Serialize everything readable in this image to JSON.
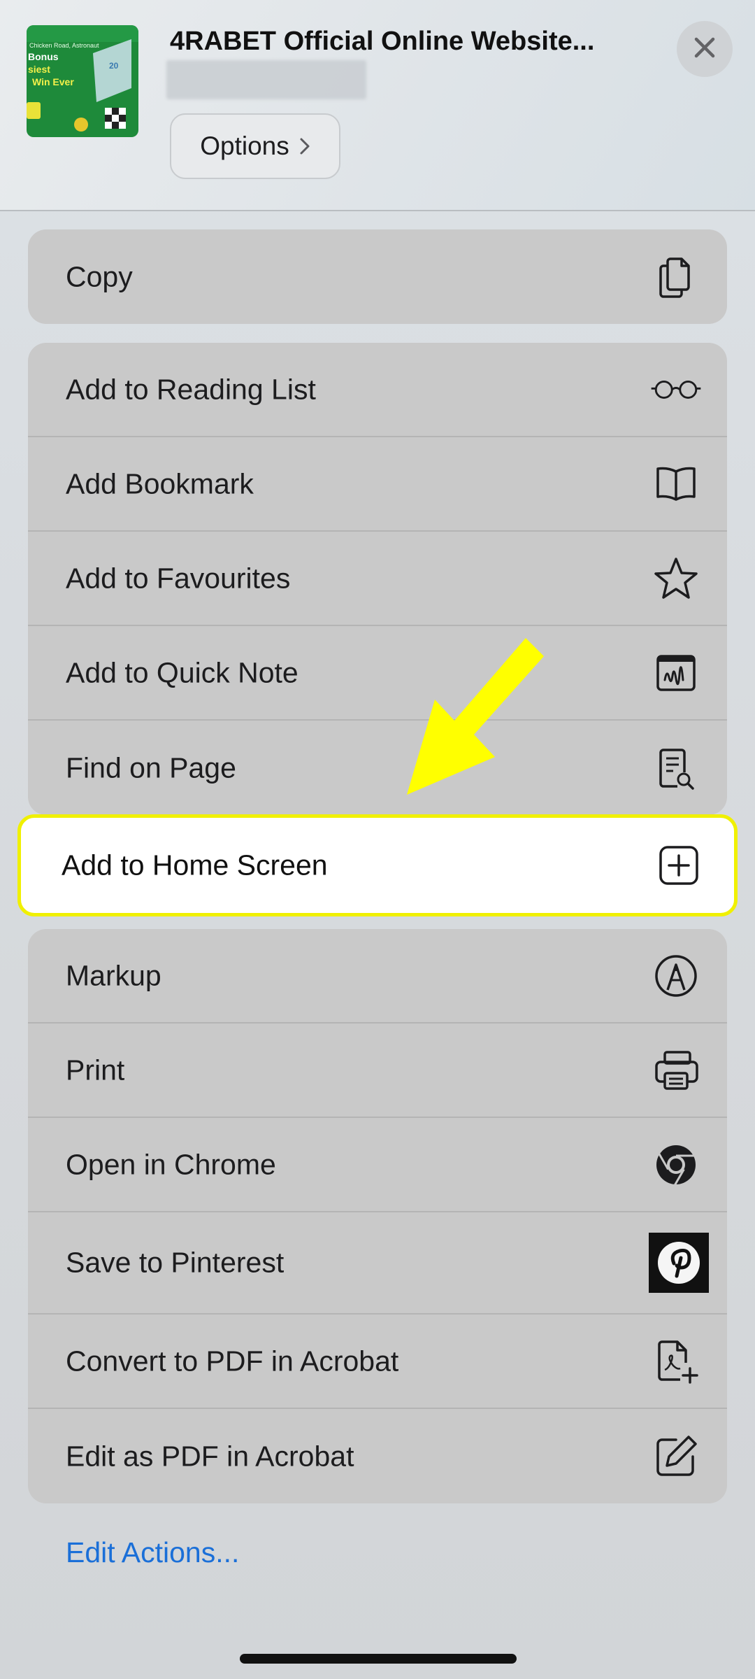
{
  "header": {
    "site_title": "4RABET Official Online Website...",
    "options_label": "Options",
    "thumbnail": {
      "line1": "Chicken Road, Astronaut",
      "line2": "Bonus",
      "line3": "siest",
      "line4": "Win Ever",
      "badge": "20"
    }
  },
  "groups": [
    {
      "items": [
        {
          "label": "Copy",
          "icon": "copy-icon"
        }
      ]
    },
    {
      "items": [
        {
          "label": "Add to Reading List",
          "icon": "glasses-icon"
        },
        {
          "label": "Add Bookmark",
          "icon": "book-icon"
        },
        {
          "label": "Add to Favourites",
          "icon": "star-icon"
        },
        {
          "label": "Add to Quick Note",
          "icon": "quick-note-icon"
        },
        {
          "label": "Find on Page",
          "icon": "find-document-icon"
        }
      ]
    },
    {
      "items": [
        {
          "label": "Add to Home Screen",
          "icon": "plus-square-icon",
          "highlighted": true
        }
      ]
    },
    {
      "items": [
        {
          "label": "Markup",
          "icon": "markup-pen-icon"
        },
        {
          "label": "Print",
          "icon": "printer-icon"
        },
        {
          "label": "Open in Chrome",
          "icon": "chrome-icon"
        },
        {
          "label": "Save to Pinterest",
          "icon": "pinterest-icon"
        },
        {
          "label": "Convert to PDF in Acrobat",
          "icon": "pdf-add-icon"
        },
        {
          "label": "Edit as PDF in Acrobat",
          "icon": "edit-square-icon"
        }
      ]
    }
  ],
  "footer": {
    "edit_actions": "Edit Actions..."
  },
  "colors": {
    "highlight_border": "#f0f000",
    "arrow": "#ffff00",
    "link": "#1a6fd8",
    "row_bg": "#c9c9c9"
  }
}
